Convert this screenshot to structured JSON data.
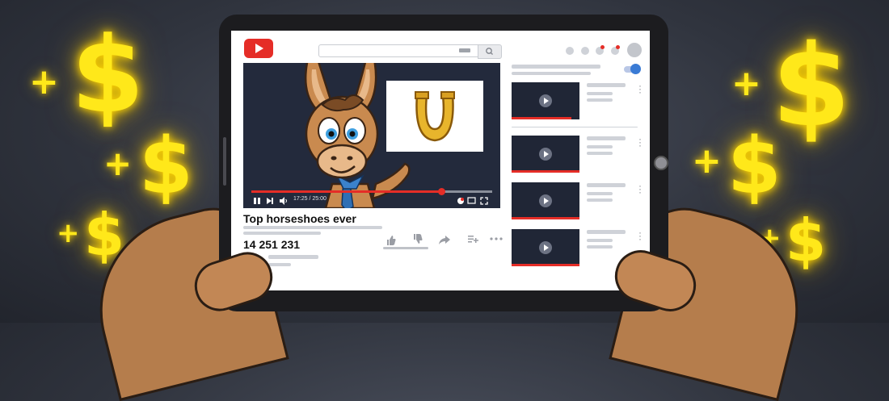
{
  "video": {
    "title": "Top horseshoes ever",
    "view_count": "14 251 231",
    "time_display": "17:25 / 25:00",
    "progress": 0.79
  },
  "icons": {
    "logo": "youtube-logo",
    "search": "search-icon",
    "play": "play-icon",
    "next": "next-icon",
    "volume": "volume-icon",
    "fullscreen": "fullscreen-icon",
    "like": "thumbs-up-icon",
    "dislike": "thumbs-down-icon",
    "share": "share-icon",
    "save": "add-to-playlist-icon",
    "more": "more-icon"
  },
  "colors": {
    "brand": "#e52d27",
    "toggle": "#3a7bd5",
    "dollar": "#ffe81a"
  },
  "decor": {
    "dollar_symbol": "$",
    "plus_symbol": "+"
  }
}
